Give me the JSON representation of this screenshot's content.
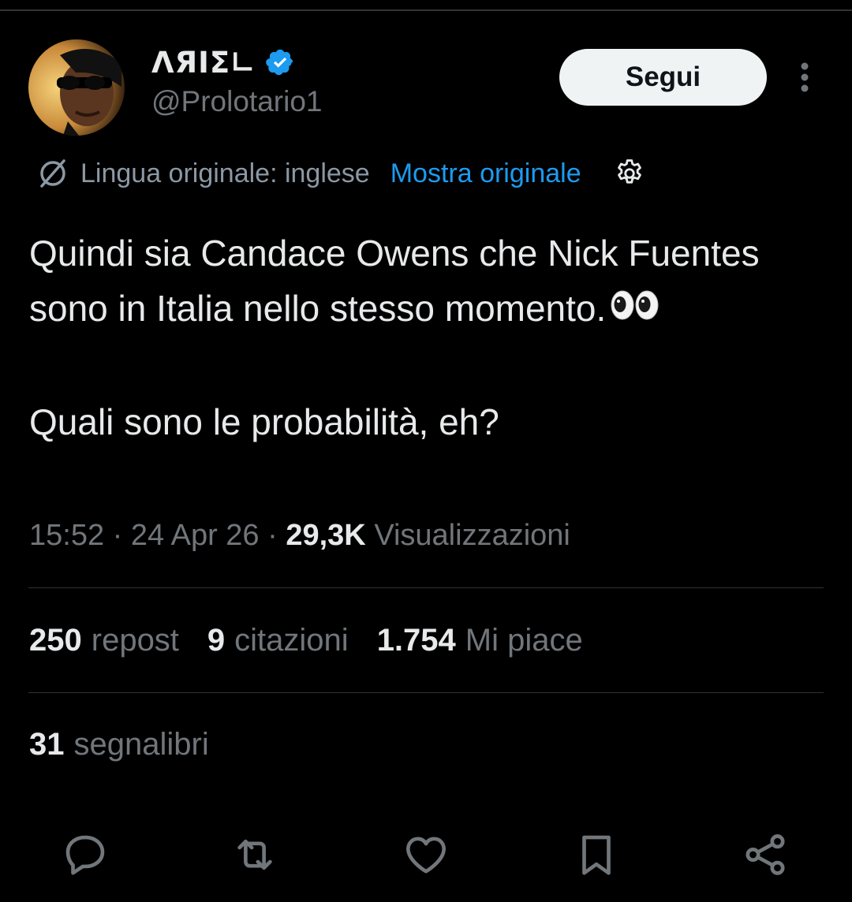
{
  "user": {
    "display_name": "ΛЯIΣ∟",
    "handle": "@Prolotario1",
    "verified": true,
    "follow_label": "Segui"
  },
  "translation": {
    "label": "Lingua originale: inglese",
    "show_original": "Mostra originale"
  },
  "tweet": {
    "paragraph_1": "Quindi sia Candace Owens che Nick Fuentes sono in Italia nello stesso momento.",
    "paragraph_2": "Quali sono le probabilità, eh?"
  },
  "meta": {
    "time": "15:52",
    "date": "24 Apr 26",
    "views_count": "29,3K",
    "views_label": "Visualizzazioni"
  },
  "stats": {
    "reposts_count": "250",
    "reposts_label": "repost",
    "quotes_count": "9",
    "quotes_label": "citazioni",
    "likes_count": "1.754",
    "likes_label": "Mi piace",
    "bookmarks_count": "31",
    "bookmarks_label": "segnalibri"
  },
  "actions": [
    "reply-icon",
    "repost-icon",
    "like-icon",
    "bookmark-icon",
    "share-icon"
  ],
  "colors": {
    "background": "#000000",
    "text_primary": "#e7e9ea",
    "text_secondary": "#71767b",
    "link": "#1d9bf0",
    "verified": "#1d9bf0",
    "divider": "#2f3336"
  }
}
